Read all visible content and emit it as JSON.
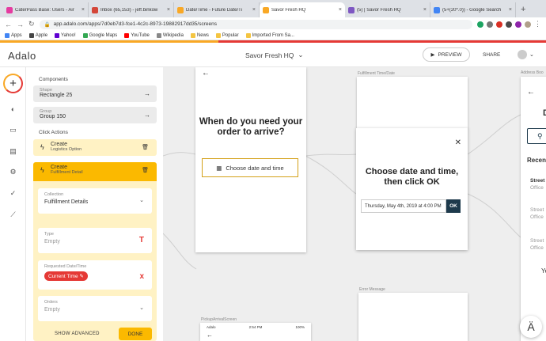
{
  "browser": {
    "tabs": [
      {
        "title": "CaterPass Base: Users - Air",
        "color": "#e53ba0"
      },
      {
        "title": "Inbox (65,153) - jeff.binkow",
        "color": "#d44638"
      },
      {
        "title": "Date/Time - Future Date/Ti",
        "color": "#f9a825"
      },
      {
        "title": "Savor Fresh HQ",
        "color": "#f9a825",
        "active": true
      },
      {
        "title": "(5) | Savor Fresh HQ",
        "color": "#7e57c2"
      },
      {
        "title": "(5+(20*.0)) - Google Search",
        "color": "#4285f4"
      }
    ],
    "new_tab": "+",
    "url": "app.adalo.com/apps/7d0eb7d3-fce1-4c2c-8973-19882917dd35/screens",
    "bookmarks": [
      "Apps",
      "Apple",
      "Yahoo!",
      "Google Maps",
      "YouTube",
      "Wikipedia",
      "News",
      "Popular",
      "Imported From Sa..."
    ]
  },
  "header": {
    "logo": "Adalo",
    "project": "Savor Fresh HQ",
    "preview": "PREVIEW",
    "share": "SHARE"
  },
  "panel": {
    "components_label": "Components",
    "shape_label": "Shape",
    "shape_value": "Rectangle 25",
    "group_label": "Group",
    "group_value": "Group 150",
    "click_actions_label": "Click Actions",
    "actions": [
      {
        "title": "Create",
        "sub": "Logistics Option"
      },
      {
        "title": "Create",
        "sub": "Fulfillment Detail"
      }
    ],
    "collection_label": "Collection",
    "collection_value": "Fulfillment Details",
    "type_label": "Type",
    "type_value": "Empty",
    "requested_label": "Requested Date/Time",
    "requested_chip": "Current Time",
    "orders_label": "Orders",
    "orders_value": "Empty",
    "show_advanced": "SHOW ADVANCED",
    "done": "DONE"
  },
  "canvas": {
    "screen1": {
      "title": "When do you need your order to arrive?",
      "button": "Choose date and time"
    },
    "label_fulfillment": "Fulfillment Time/Date",
    "label_address": "Address Boo",
    "label_error": "Error Message",
    "label_pickup": "PickupArrivalScreen",
    "modal": {
      "title": "Choose date and time, then click OK",
      "datetime": "Thursday, May 4th, 2019 at 4:00 PM",
      "ok": "OK"
    },
    "status": {
      "carrier": "Adalo",
      "time": "2:54 PM",
      "battery": "100%"
    },
    "right_screen": {
      "letter": "D",
      "recent": "Recen",
      "items": [
        {
          "a": "Street",
          "b": "Office"
        },
        {
          "a": "Street",
          "b": "Office"
        },
        {
          "a": "Street",
          "b": "Office"
        }
      ],
      "bottom": "Yo"
    }
  }
}
